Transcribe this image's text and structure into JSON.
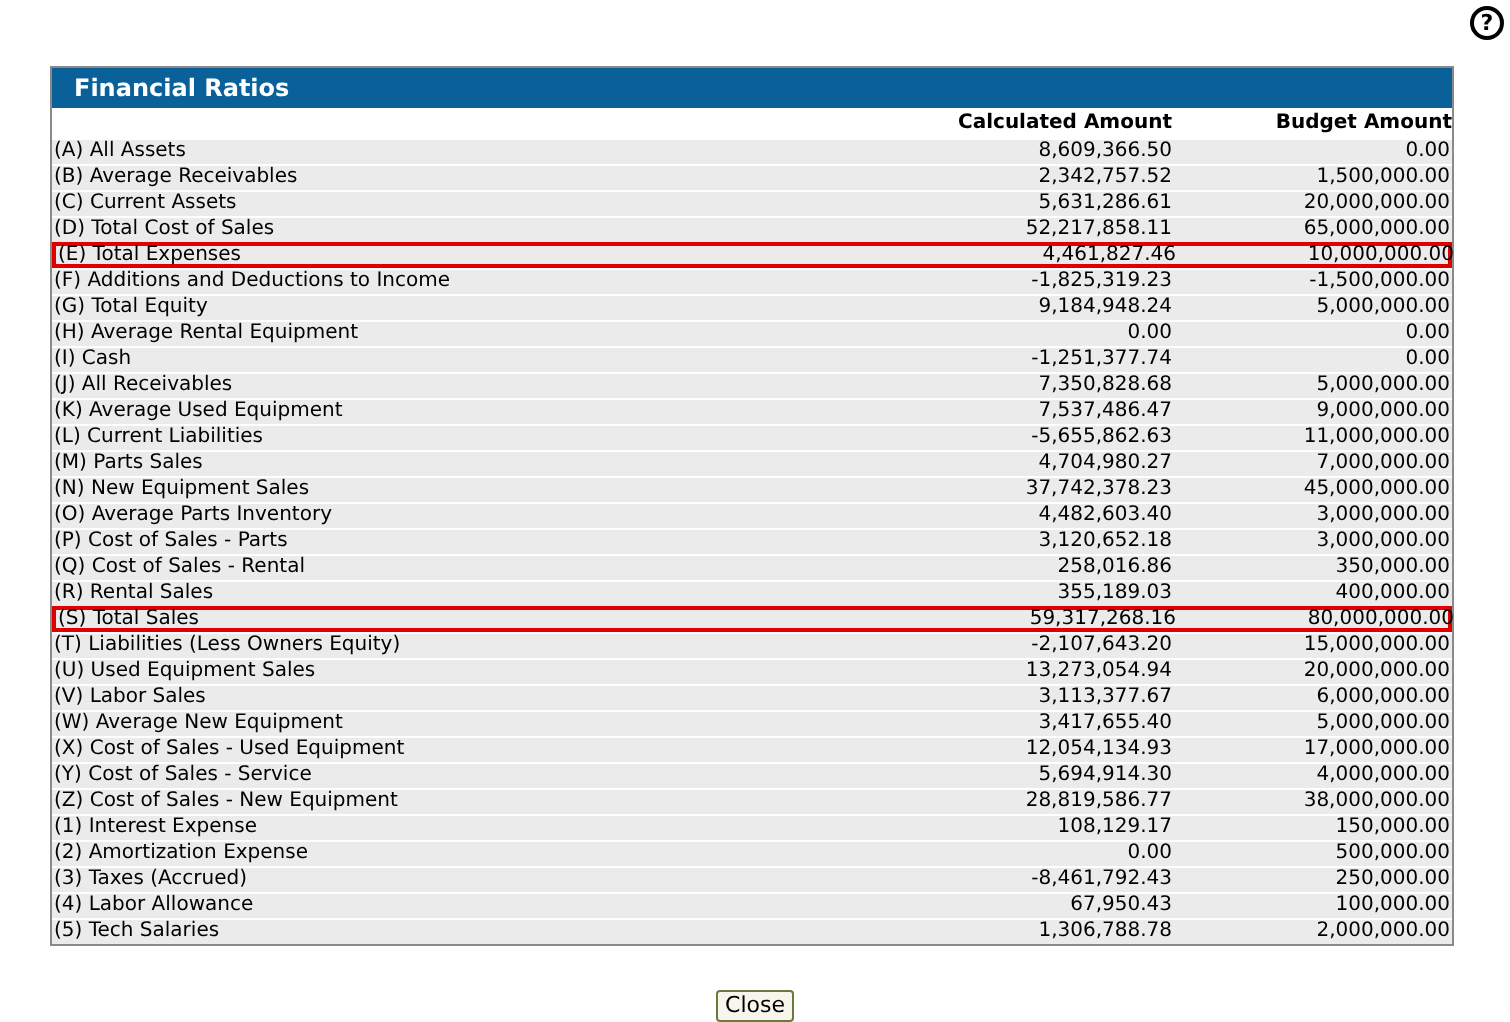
{
  "help_button": {
    "label": "?"
  },
  "panel": {
    "title": "Financial Ratios",
    "columns": [
      "",
      "Calculated Amount",
      "Budget Amount"
    ],
    "rows": [
      {
        "label": "(A) All Assets",
        "calculated": "8,609,366.50",
        "budget": "0.00",
        "highlighted": false
      },
      {
        "label": "(B) Average Receivables",
        "calculated": "2,342,757.52",
        "budget": "1,500,000.00",
        "highlighted": false
      },
      {
        "label": "(C) Current Assets",
        "calculated": "5,631,286.61",
        "budget": "20,000,000.00",
        "highlighted": false
      },
      {
        "label": "(D) Total Cost of Sales",
        "calculated": "52,217,858.11",
        "budget": "65,000,000.00",
        "highlighted": false
      },
      {
        "label": "(E) Total Expenses",
        "calculated": "4,461,827.46",
        "budget": "10,000,000.00",
        "highlighted": true
      },
      {
        "label": "(F) Additions and Deductions to Income",
        "calculated": "-1,825,319.23",
        "budget": "-1,500,000.00",
        "highlighted": false
      },
      {
        "label": "(G) Total Equity",
        "calculated": "9,184,948.24",
        "budget": "5,000,000.00",
        "highlighted": false
      },
      {
        "label": "(H) Average Rental Equipment",
        "calculated": "0.00",
        "budget": "0.00",
        "highlighted": false
      },
      {
        "label": "(I) Cash",
        "calculated": "-1,251,377.74",
        "budget": "0.00",
        "highlighted": false
      },
      {
        "label": "(J) All Receivables",
        "calculated": "7,350,828.68",
        "budget": "5,000,000.00",
        "highlighted": false
      },
      {
        "label": "(K) Average Used Equipment",
        "calculated": "7,537,486.47",
        "budget": "9,000,000.00",
        "highlighted": false
      },
      {
        "label": "(L) Current Liabilities",
        "calculated": "-5,655,862.63",
        "budget": "11,000,000.00",
        "highlighted": false
      },
      {
        "label": "(M) Parts Sales",
        "calculated": "4,704,980.27",
        "budget": "7,000,000.00",
        "highlighted": false
      },
      {
        "label": "(N) New Equipment Sales",
        "calculated": "37,742,378.23",
        "budget": "45,000,000.00",
        "highlighted": false
      },
      {
        "label": "(O) Average Parts Inventory",
        "calculated": "4,482,603.40",
        "budget": "3,000,000.00",
        "highlighted": false
      },
      {
        "label": "(P) Cost of Sales - Parts",
        "calculated": "3,120,652.18",
        "budget": "3,000,000.00",
        "highlighted": false
      },
      {
        "label": "(Q) Cost of Sales - Rental",
        "calculated": "258,016.86",
        "budget": "350,000.00",
        "highlighted": false
      },
      {
        "label": "(R) Rental Sales",
        "calculated": "355,189.03",
        "budget": "400,000.00",
        "highlighted": false
      },
      {
        "label": "(S) Total Sales",
        "calculated": "59,317,268.16",
        "budget": "80,000,000.00",
        "highlighted": true
      },
      {
        "label": "(T) Liabilities (Less Owners Equity)",
        "calculated": "-2,107,643.20",
        "budget": "15,000,000.00",
        "highlighted": false
      },
      {
        "label": "(U) Used Equipment Sales",
        "calculated": "13,273,054.94",
        "budget": "20,000,000.00",
        "highlighted": false
      },
      {
        "label": "(V) Labor Sales",
        "calculated": "3,113,377.67",
        "budget": "6,000,000.00",
        "highlighted": false
      },
      {
        "label": "(W) Average New Equipment",
        "calculated": "3,417,655.40",
        "budget": "5,000,000.00",
        "highlighted": false
      },
      {
        "label": "(X) Cost of Sales - Used Equipment",
        "calculated": "12,054,134.93",
        "budget": "17,000,000.00",
        "highlighted": false
      },
      {
        "label": "(Y) Cost of Sales - Service",
        "calculated": "5,694,914.30",
        "budget": "4,000,000.00",
        "highlighted": false
      },
      {
        "label": "(Z) Cost of Sales - New Equipment",
        "calculated": "28,819,586.77",
        "budget": "38,000,000.00",
        "highlighted": false
      },
      {
        "label": "(1) Interest Expense",
        "calculated": "108,129.17",
        "budget": "150,000.00",
        "highlighted": false
      },
      {
        "label": "(2) Amortization Expense",
        "calculated": "0.00",
        "budget": "500,000.00",
        "highlighted": false
      },
      {
        "label": "(3) Taxes (Accrued)",
        "calculated": "-8,461,792.43",
        "budget": "250,000.00",
        "highlighted": false
      },
      {
        "label": "(4) Labor Allowance",
        "calculated": "67,950.43",
        "budget": "100,000.00",
        "highlighted": false
      },
      {
        "label": "(5) Tech Salaries",
        "calculated": "1,306,788.78",
        "budget": "2,000,000.00",
        "highlighted": false
      }
    ]
  },
  "close_button": {
    "label": "Close"
  }
}
